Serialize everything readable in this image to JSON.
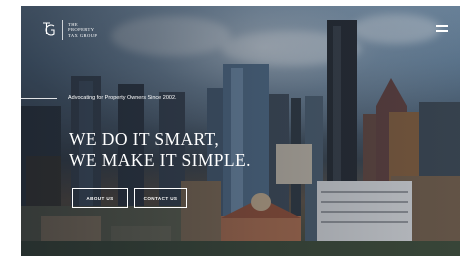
{
  "brand": {
    "name_lines": [
      "THE",
      "PROPERTY",
      "TAX GROUP"
    ],
    "logo_icon": "tpg-monogram-icon"
  },
  "header": {
    "menu_icon": "hamburger-menu-icon"
  },
  "hero": {
    "tagline": "Advocating for Property Owners Since 2002.",
    "headline_line1": "WE DO IT SMART,",
    "headline_line2": "WE MAKE IT SIMPLE."
  },
  "buttons": {
    "about_label": "ABOUT US",
    "contact_label": "CONTACT US"
  },
  "colors": {
    "text": "#ffffff",
    "button_border": "#ffffff",
    "page_background": "#ffffff"
  }
}
